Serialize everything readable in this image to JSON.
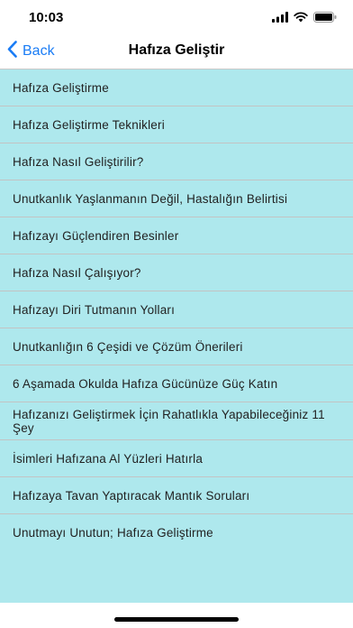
{
  "status": {
    "time": "10:03"
  },
  "nav": {
    "back_label": "Back",
    "title": "Hafıza Geliştir"
  },
  "list": {
    "items": [
      "Hafıza Geliştirme",
      "Hafıza Geliştirme Teknikleri",
      "Hafıza Nasıl Geliştirilir?",
      "Unutkanlık Yaşlanmanın Değil, Hastalığın Belirtisi",
      "Hafızayı Güçlendiren Besinler",
      "Hafıza Nasıl Çalışıyor?",
      "Hafızayı Diri Tutmanın Yolları",
      "Unutkanlığın 6 Çeşidi ve Çözüm Önerileri",
      "6 Aşamada Okulda Hafıza Gücünüze Güç Katın",
      "Hafızanızı Geliştirmek İçin Rahatlıkla Yapabileceğiniz 11 Şey",
      "İsimleri Hafızana Al Yüzleri Hatırla",
      "Hafızaya Tavan Yaptıracak Mantık Soruları",
      "Unutmayı Unutun; Hafıza Geliştirme"
    ]
  },
  "colors": {
    "accent": "#1a7cf5",
    "list_background": "#aee8ed"
  }
}
